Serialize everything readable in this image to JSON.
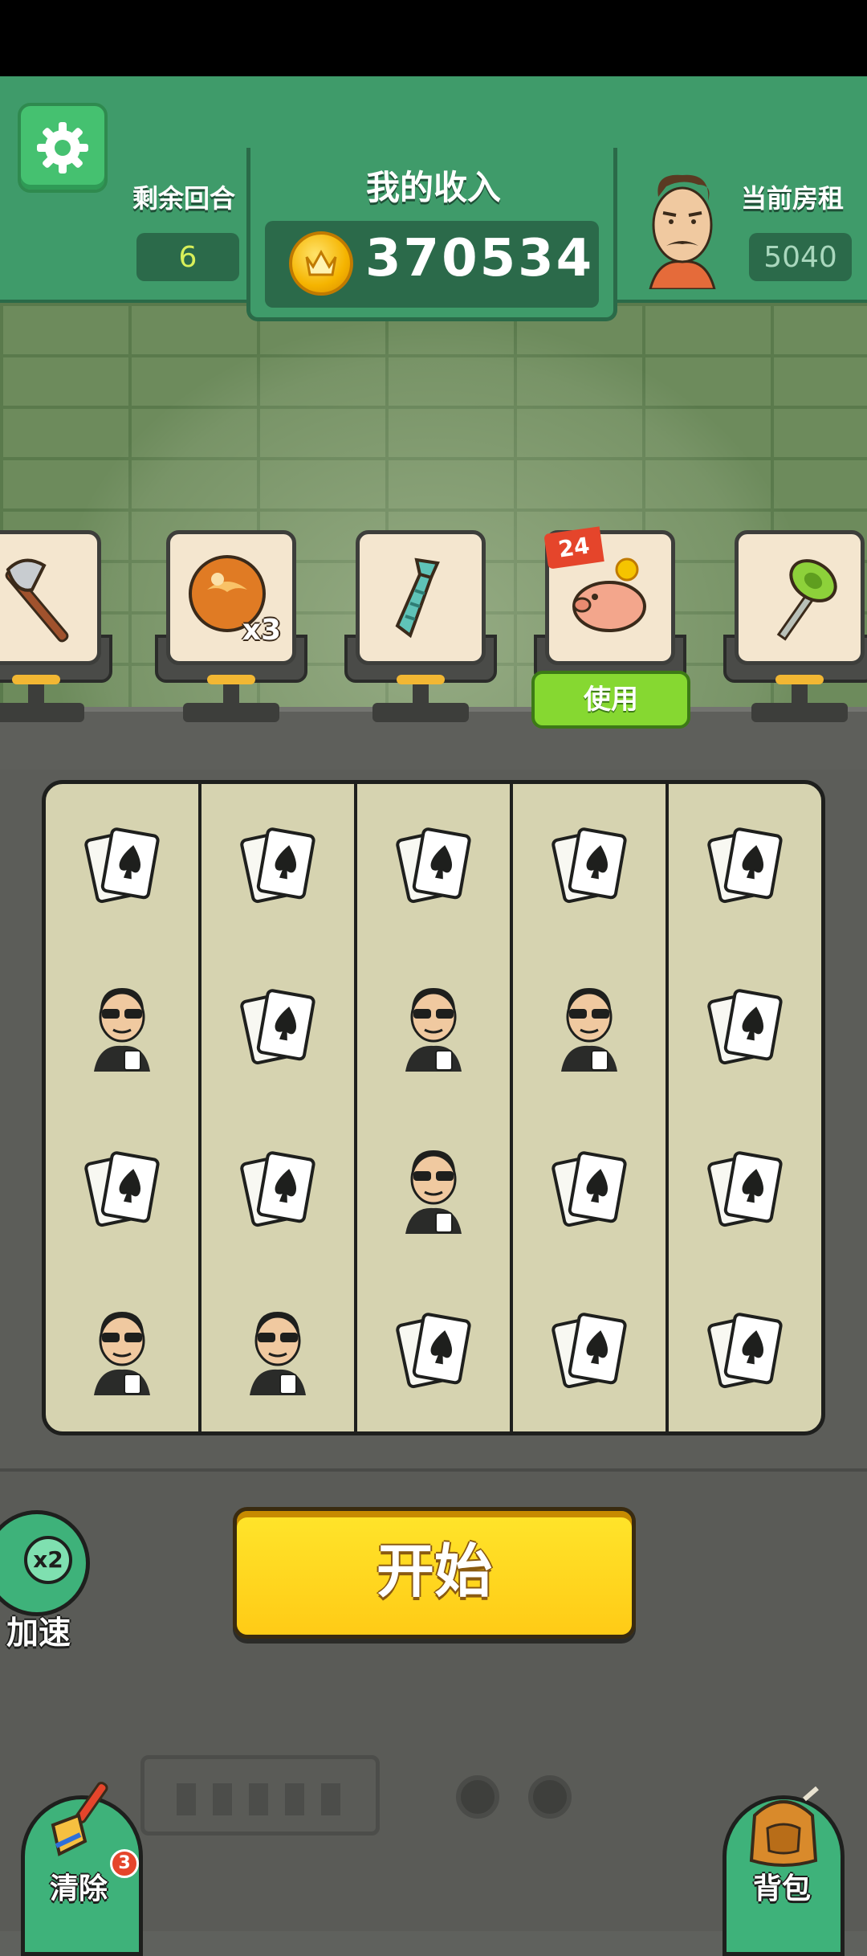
{
  "header": {
    "rounds_label": "剩余回合",
    "rounds_value": "6",
    "income_title": "我的收入",
    "income_value": "370534",
    "rent_label": "当前房租",
    "rent_value": "5040"
  },
  "items": [
    {
      "name": "axe",
      "icon": "axe-icon"
    },
    {
      "name": "bread-x3",
      "icon": "bread-icon",
      "multiplier": "x3"
    },
    {
      "name": "tie",
      "icon": "tie-icon"
    },
    {
      "name": "piggy-bank",
      "icon": "piggy-bank-icon",
      "badge": "24",
      "action": "使用"
    },
    {
      "name": "plunger",
      "icon": "plunger-icon"
    }
  ],
  "grid": [
    [
      "cards",
      "cards",
      "cards",
      "cards",
      "cards"
    ],
    [
      "gangster",
      "cards",
      "gangster",
      "gangster",
      "cards"
    ],
    [
      "cards",
      "cards",
      "gangster",
      "cards",
      "cards"
    ],
    [
      "gangster",
      "gangster",
      "cards",
      "cards",
      "cards"
    ]
  ],
  "controls": {
    "start_label": "开始",
    "speed_multiplier": "x2",
    "speed_label": "加速",
    "clear_label": "清除",
    "clear_count": "3",
    "bag_label": "背包"
  },
  "colors": {
    "header_green": "#3f9b6a",
    "start_yellow": "#ffd21f",
    "use_green": "#86d831"
  }
}
